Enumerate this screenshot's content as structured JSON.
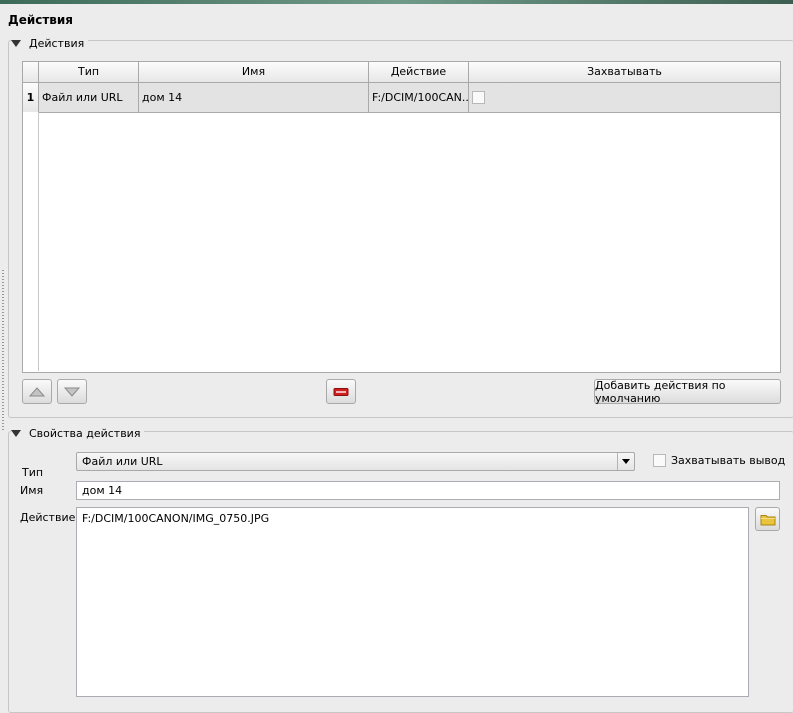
{
  "page_title": "Действия",
  "actions_group": {
    "title": "Действия",
    "columns": [
      "Тип",
      "Имя",
      "Действие",
      "Захватывать"
    ],
    "rows": [
      {
        "num": "1",
        "type": "Файл или URL",
        "name": "дом 14",
        "action": "F:/DCIM/100CAN...",
        "capture": false
      }
    ],
    "buttons": {
      "default_actions_label": "Добавить действия по умолчанию"
    }
  },
  "properties_group": {
    "title": "Свойства действия",
    "type_label": "Тип",
    "type_value": "Файл или URL",
    "capture_label": "Захватывать вывод",
    "name_label": "Имя",
    "name_value": "дом 14",
    "action_label": "Действие",
    "action_value": "F:/DCIM/100CANON/IMG_0750.JPG"
  },
  "icons": {
    "move_up": "triangle-up-icon",
    "move_down": "triangle-down-icon",
    "remove": "remove-icon",
    "folder": "folder-icon",
    "collapse": "collapse-triangle-icon"
  },
  "colors": {
    "remove_red": "#d01f1f",
    "folder_yellow": "#e9c43c"
  }
}
